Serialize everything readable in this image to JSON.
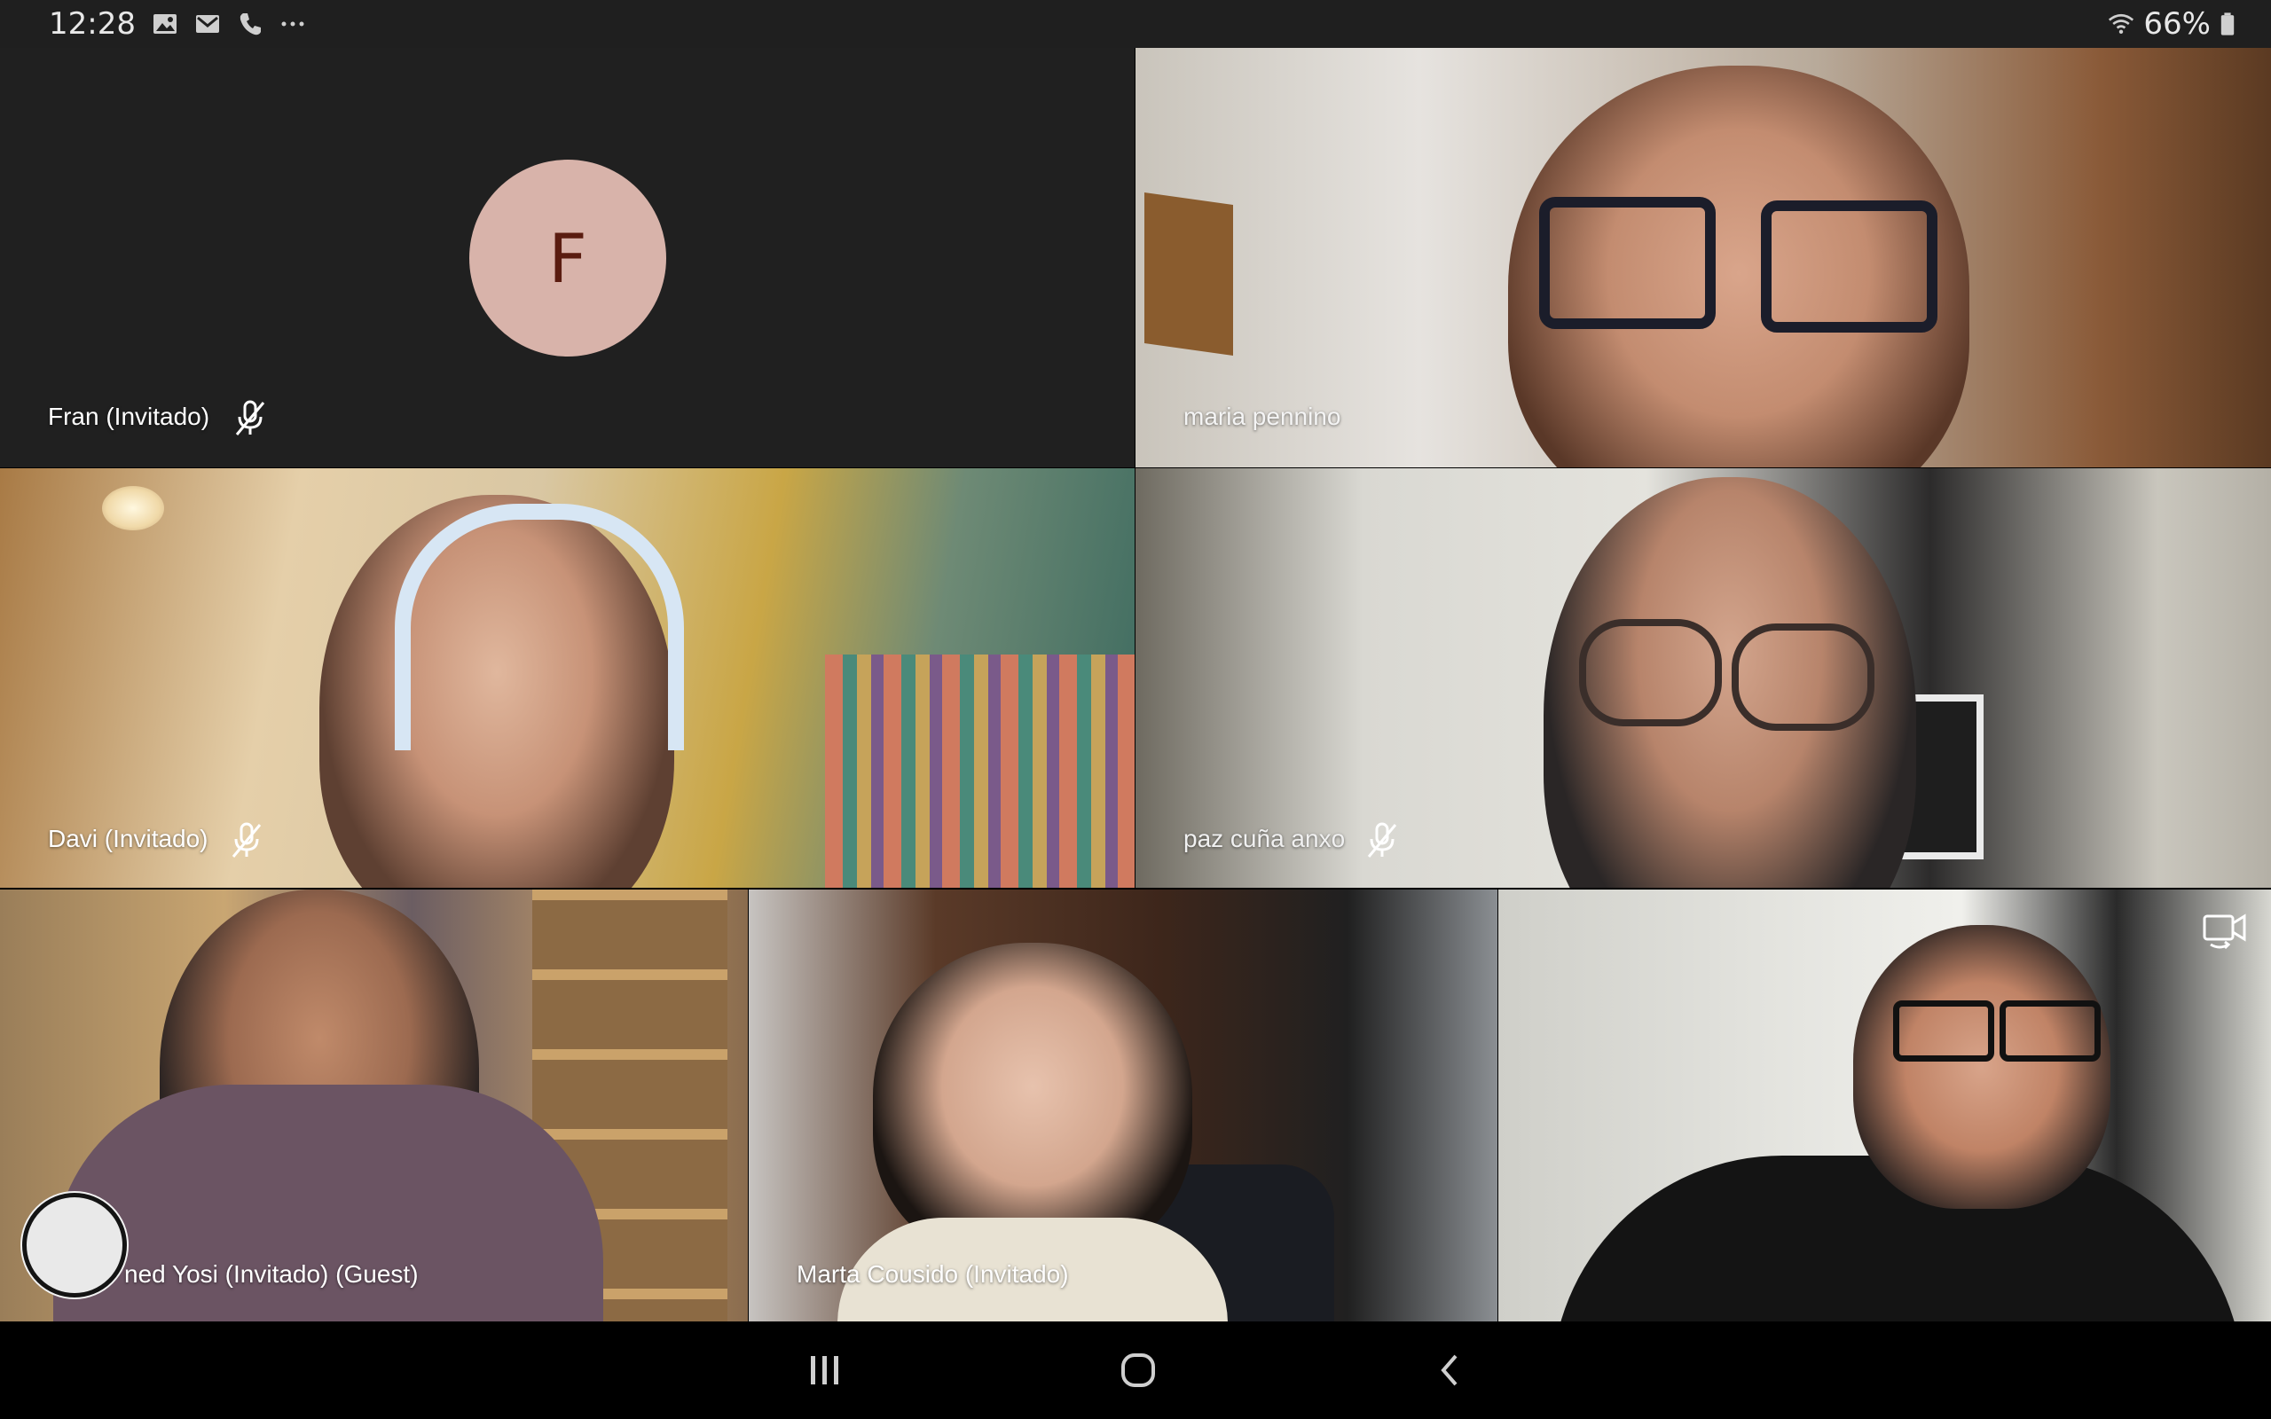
{
  "status_bar": {
    "time": "12:28",
    "notification_icons": [
      "image-icon",
      "gmail-icon",
      "phone-icon",
      "more-icon"
    ],
    "battery_percent": "66%",
    "wifi": true
  },
  "participants": [
    {
      "name": "Fran (Invitado)",
      "muted": true,
      "avatar_letter": "F",
      "avatar_color": "#d8b3aa",
      "video": false
    },
    {
      "name": "maria pennino",
      "muted": false,
      "video": true
    },
    {
      "name": "Davi (Invitado)",
      "muted": true,
      "video": true
    },
    {
      "name": "paz cuña anxo",
      "muted": true,
      "video": true
    },
    {
      "name": "ned Yosi (Invitado) (Guest)",
      "muted": false,
      "video": true
    },
    {
      "name": "Marta Cousido (Invitado)",
      "muted": false,
      "video": true
    },
    {
      "name": "",
      "muted": false,
      "video": true
    }
  ],
  "nav_bar": {
    "buttons": [
      "recent-apps-icon",
      "home-icon",
      "back-icon"
    ]
  }
}
